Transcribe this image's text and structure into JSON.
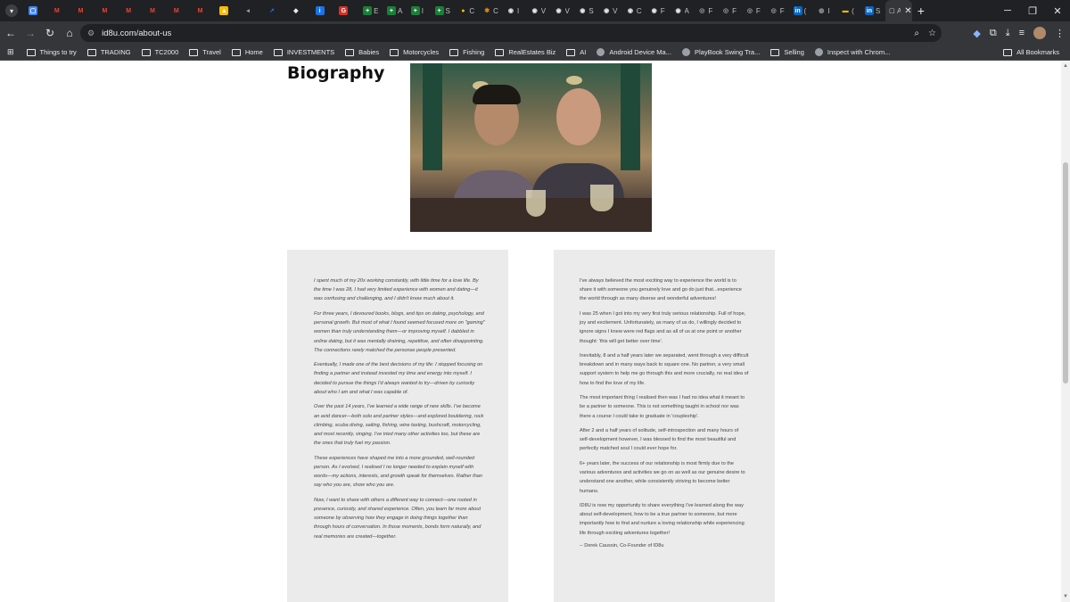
{
  "browser": {
    "url": "id8u.com/about-us",
    "tabs": [
      {
        "icon": "doc-icon",
        "color": "#4285f4",
        "glyph": "▢"
      },
      {
        "icon": "gmail-icon",
        "color": "#ea4335",
        "glyph": "M"
      },
      {
        "icon": "gmail-icon",
        "color": "#ea4335",
        "glyph": "M"
      },
      {
        "icon": "gmail-icon",
        "color": "#ea4335",
        "glyph": "M"
      },
      {
        "icon": "gmail-icon",
        "color": "#ea4335",
        "glyph": "M"
      },
      {
        "icon": "gmail-icon",
        "color": "#ea4335",
        "glyph": "M"
      },
      {
        "icon": "gmail-icon",
        "color": "#ea4335",
        "glyph": "M"
      },
      {
        "icon": "gmail-icon",
        "color": "#ea4335",
        "glyph": "M"
      },
      {
        "icon": "drive-icon",
        "color": "#fbbc04",
        "glyph": "▲"
      },
      {
        "icon": "audio-icon",
        "color": "#9aa0a6",
        "glyph": "◂"
      },
      {
        "icon": "chart-icon",
        "color": "#1a73e8",
        "glyph": "↗"
      },
      {
        "icon": "shield-icon",
        "color": "#e8eaed",
        "glyph": "◆"
      },
      {
        "icon": "info-icon",
        "color": "#1a73e8",
        "glyph": "i"
      },
      {
        "icon": "app-icon",
        "color": "#d93025",
        "glyph": "G"
      },
      {
        "icon": "sheets-icon",
        "color": "#188038",
        "glyph": "+",
        "title": "E"
      },
      {
        "icon": "sheets-icon",
        "color": "#188038",
        "glyph": "+",
        "title": "A"
      },
      {
        "icon": "sheets-icon",
        "color": "#188038",
        "glyph": "+",
        "title": "I"
      },
      {
        "icon": "sheets-icon",
        "color": "#188038",
        "glyph": "+",
        "title": "S"
      },
      {
        "icon": "coin-icon",
        "color": "#fbbc04",
        "glyph": "●",
        "title": "C"
      },
      {
        "icon": "star-icon",
        "color": "#ea8600",
        "glyph": "✱",
        "title": "C"
      },
      {
        "icon": "github-icon",
        "color": "#e8eaed",
        "glyph": "◉",
        "title": "I"
      },
      {
        "icon": "github-icon",
        "color": "#e8eaed",
        "glyph": "◉",
        "title": "V"
      },
      {
        "icon": "github-icon",
        "color": "#e8eaed",
        "glyph": "◉",
        "title": "V"
      },
      {
        "icon": "github-icon",
        "color": "#e8eaed",
        "glyph": "◉",
        "title": "S"
      },
      {
        "icon": "github-icon",
        "color": "#e8eaed",
        "glyph": "◉",
        "title": "V"
      },
      {
        "icon": "github-icon",
        "color": "#e8eaed",
        "glyph": "◉",
        "title": "C"
      },
      {
        "icon": "github-icon",
        "color": "#e8eaed",
        "glyph": "◉",
        "title": "F"
      },
      {
        "icon": "github-icon",
        "color": "#e8eaed",
        "glyph": "◉",
        "title": "A"
      },
      {
        "icon": "site-icon",
        "color": "#9aa0a6",
        "glyph": "◎",
        "title": "F"
      },
      {
        "icon": "site-icon",
        "color": "#9aa0a6",
        "glyph": "◎",
        "title": "F"
      },
      {
        "icon": "site-icon",
        "color": "#9aa0a6",
        "glyph": "◎",
        "title": "F"
      },
      {
        "icon": "site-icon",
        "color": "#9aa0a6",
        "glyph": "◎",
        "title": "F"
      },
      {
        "icon": "linkedin-icon",
        "color": "#0a66c2",
        "glyph": "in",
        "title": "("
      },
      {
        "icon": "globe-icon",
        "color": "#9aa0a6",
        "glyph": "◍",
        "title": "I"
      },
      {
        "icon": "flag-icon",
        "color": "#fbbc04",
        "glyph": "▬",
        "title": "("
      },
      {
        "icon": "linkedin-icon",
        "color": "#0a66c2",
        "glyph": "in",
        "title": "S"
      },
      {
        "icon": "page-icon",
        "color": "#9aa0a6",
        "glyph": "▢",
        "title": "A",
        "active": true
      }
    ],
    "bookmarks_bar": [
      {
        "label": "Things to try",
        "type": "folder"
      },
      {
        "label": "TRADING",
        "type": "folder"
      },
      {
        "label": "TC2000",
        "type": "folder"
      },
      {
        "label": "Travel",
        "type": "folder"
      },
      {
        "label": "Home",
        "type": "folder"
      },
      {
        "label": "INVESTMENTS",
        "type": "folder"
      },
      {
        "label": "Babies",
        "type": "folder"
      },
      {
        "label": "Motorcycles",
        "type": "folder"
      },
      {
        "label": "Fishing",
        "type": "folder"
      },
      {
        "label": "RealEstates Biz",
        "type": "folder"
      },
      {
        "label": "AI",
        "type": "folder"
      },
      {
        "label": "Android Device Ma...",
        "type": "link"
      },
      {
        "label": "PlayBook Swing Tra...",
        "type": "link"
      },
      {
        "label": "Selling",
        "type": "folder"
      },
      {
        "label": "Inspect with Chrom...",
        "type": "link"
      }
    ],
    "all_bookmarks_label": "All Bookmarks"
  },
  "page": {
    "title": "Biography",
    "left_column": [
      "I spent much of my 20s working constantly, with little time for a love life. By the time I was 28, I had very limited experience with women and dating—it was confusing and challenging, and I didn't know much about it.",
      "For three years, I devoured books, blogs, and tips on dating, psychology, and personal growth. But most of what I found seemed focused more on \"gaming\" women than truly understanding them—or improving myself. I dabbled in online dating, but it was mentally draining, repetitive, and often disappointing. The connections rarely matched the personas people presented.",
      "Eventually, I made one of the best decisions of my life: I stopped focusing on finding a partner and instead invested my time and energy into myself. I decided to pursue the things I'd always wanted to try—driven by curiosity about who I am and what I was capable of.",
      "Over the past 14 years, I've learned a wide range of new skills. I've become an avid dancer—both solo and partner styles—and explored bouldering, rock climbing, scuba diving, sailing, fishing, wine tasting, bushcraft, motorcycling, and most recently, singing. I've tried many other activities too, but these are the ones that truly fuel my passion.",
      "These experiences have shaped me into a more grounded, well-rounded person. As I evolved, I realised I no longer needed to explain myself with words—my actions, interests, and growth speak for themselves. Rather than say who you are, show who you are.",
      "Now, I want to share with others a different way to connect—one rooted in presence, curiosity, and shared experience. Often, you learn far more about someone by observing how they engage in doing things together than through hours of conversation. In those moments, bonds form naturally, and real memories are created—together."
    ],
    "right_column": [
      "I've always believed the most exciting way to experience the world is to share it with someone you genuinely love and go do just that...experience the world through as many diverse and wonderful adventures!",
      "I was 25 when I got into my very first truly serious relationship. Full of hope, joy and excitement. Unfortunately, as many of us do, I willingly decided to ignore signs I knew were red flags and as all of us at one point or another thought: 'this will get better over time'.",
      "Inevitably, 8 and a half years later we separated, went through a very difficult breakdown and in many ways back to square one. No partner, a very small support system to help me go through this and more crucially, no real idea of how to find the love of my life.",
      "The most important thing I realised then was I had no idea what it meant to be a partner to someone. This is not something taught in school nor was there a course I could take to graduate in 'coupleship'.",
      "After 2 and a half years of solitude, self-introspection and many hours of self-development however, I was blessed to find the most beautiful and perfectly matched soul I could ever hope for.",
      "6+ years later, the success of our relationship is most firmly due to the various adventures and activities we go on as well as our genuine desire to understand one another, while consistently striving to become better humans.",
      "ID8U is now my opportunity to share everything I've learned along the way about self-development, how to be a true partner to someone, but more importantly how to find and nurture a loving relationship while experiencing life through exciting adventures together!"
    ],
    "right_signature": "-- Derek Caussin, Co-Founder of ID8u"
  }
}
